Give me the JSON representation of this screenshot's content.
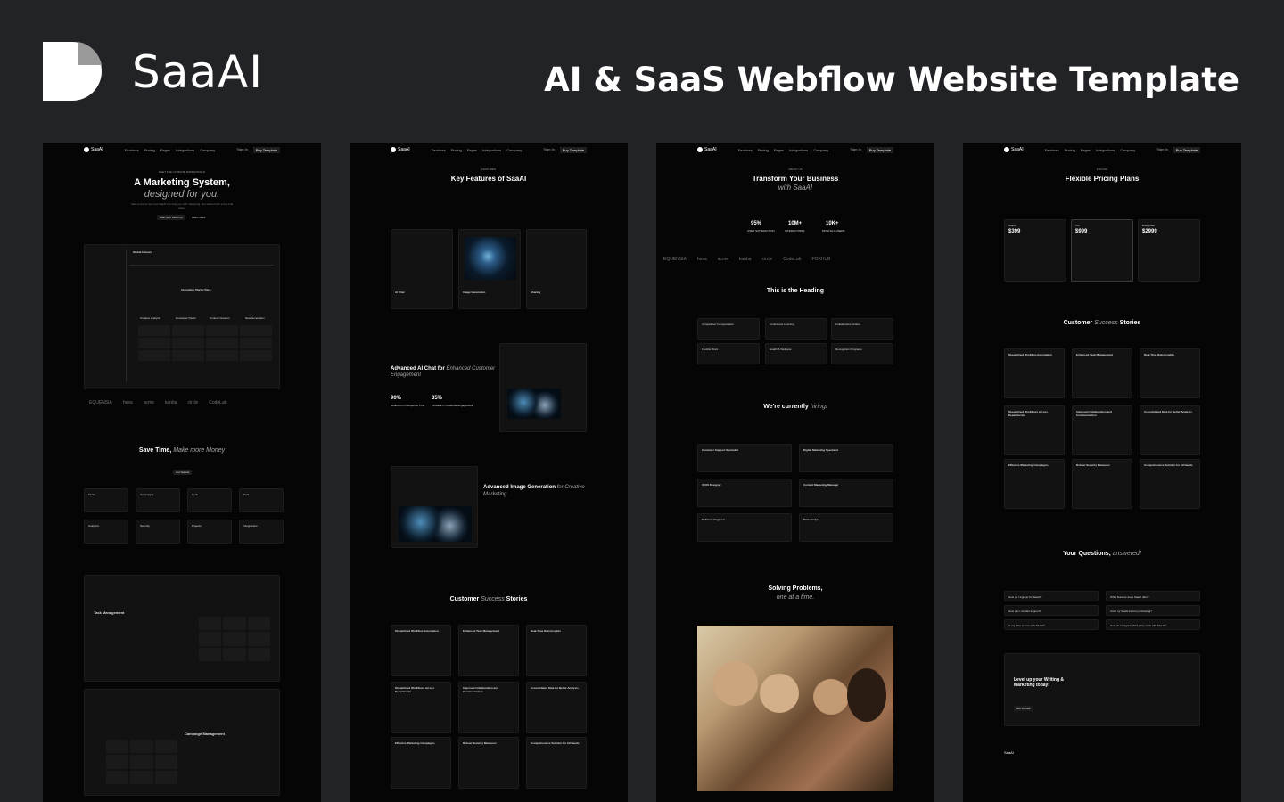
{
  "brand": {
    "name": "SaaAI"
  },
  "headline": "AI & SaaS Webflow Website Template",
  "nav": {
    "brand": "SaaAI",
    "links": [
      "Features",
      "Pricing",
      "Pages",
      "Integrations",
      "Company"
    ],
    "login": "Sign In",
    "cta": "Buy Template"
  },
  "panel1": {
    "tag": "MEET THE ULTIMATE MARKETING AI",
    "hero_title": "A Marketing System,",
    "hero_italic": "designed for you.",
    "hero_sub": "Take a tour to see how SaaAI can help you with marketing. Get started with a free trial today.",
    "btn_primary": "Start your free Trial",
    "btn_secondary": "Learn More",
    "app": {
      "title": "Global Inbound",
      "pack": "Innovation Starter Pack",
      "columns": [
        "Creative Analysis",
        "Developer Packs",
        "Content Creation",
        "New Generation"
      ]
    },
    "logos": [
      "EQUENSIA",
      "hexa",
      "acme",
      "kanba",
      "circle",
      "CodeLab"
    ],
    "section_title": "Save Time,",
    "section_italic": "Make more Money",
    "section_btn": "Get Started",
    "features": [
      "Tasks",
      "Campaigns",
      "Code",
      "Data",
      "Analytics",
      "Security",
      "Projects",
      "Integrations"
    ],
    "block1": "Task Management",
    "block2": "Campaign Management"
  },
  "panel2": {
    "tag": "FEATURES",
    "title": "Key Features of SaaAI",
    "cards": [
      "AI Chat",
      "Image Generation",
      "Sharing"
    ],
    "chat_title": "Advanced AI Chat for",
    "chat_italic": "Enhanced Customer Engagement",
    "stats": [
      "90%",
      "35%"
    ],
    "stat_labels": [
      "Reduction in Response Time",
      "Increase in Customer Engagement"
    ],
    "image_title": "Advanced Image Generation",
    "image_italic": "for Creative Marketing",
    "testimonials_title": "Customer",
    "testimonials_italic": "Success",
    "testimonials_tail": "Stories",
    "stories": [
      "Streamlined Workflow Automation",
      "Enhanced Task Management",
      "Real-Time Data Insights",
      "Streamlined Workflows Across Departments",
      "Improved Collaboration and Communication",
      "Consolidated Data for Better Analysis",
      "Effective Marketing Campaigns",
      "Robust Security Measures",
      "Comprehensive Solution for All Needs"
    ]
  },
  "panel3": {
    "tag": "ABOUT US",
    "title": "Transform Your Business",
    "italic": "with SaaAI",
    "stats": [
      {
        "value": "95%",
        "label": "USER SATISFACTION"
      },
      {
        "value": "10M+",
        "label": "INTERACTIONS"
      },
      {
        "value": "10K+",
        "label": "MONTHLY USERS"
      }
    ],
    "logos": [
      "EQUENSIA",
      "hexa",
      "acme",
      "kanba",
      "circle",
      "CodeLab",
      "FOXHUB"
    ],
    "heading": "This is the Heading",
    "values": [
      "Competitive Compensation",
      "Continuous Learning",
      "Collaborative Culture",
      "Flexible Work",
      "Health & Wellness",
      "Recognition Programs"
    ],
    "hiring_title": "We're currently",
    "hiring_italic": "hiring!",
    "jobs": [
      "Customer Support Specialist",
      "Digital Marketing Specialist",
      "UX/UI Designer",
      "Content Marketing Manager",
      "Software Engineer",
      "Data Analyst"
    ],
    "solving_title": "Solving Problems,",
    "solving_italic": "one at a time."
  },
  "panel4": {
    "tag": "PRICING",
    "title": "Flexible Pricing Plans",
    "plans": [
      {
        "name": "Starter",
        "price": "$399"
      },
      {
        "name": "Pro",
        "price": "$999"
      },
      {
        "name": "Enterprise",
        "price": "$2999"
      }
    ],
    "testimonials_title": "Customer",
    "testimonials_italic": "Success",
    "testimonials_tail": "Stories",
    "faq_title": "Your Questions,",
    "faq_italic": "answered!",
    "faqs": [
      "How do I sign up for SaaAI?",
      "What features does SaaAI offer?",
      "How can I contact support?",
      "Can I try SaaAI before purchasing?",
      "Is my data secure with SaaAI?",
      "How do I integrate third-party tools with SaaAI?"
    ],
    "cta_title": "Level up your Writing & Marketing today!",
    "cta_btn": "Get Started",
    "footer_brand": "SaaAI"
  },
  "colors": {
    "page_bg": "#222326",
    "panel_bg": "#050505"
  }
}
